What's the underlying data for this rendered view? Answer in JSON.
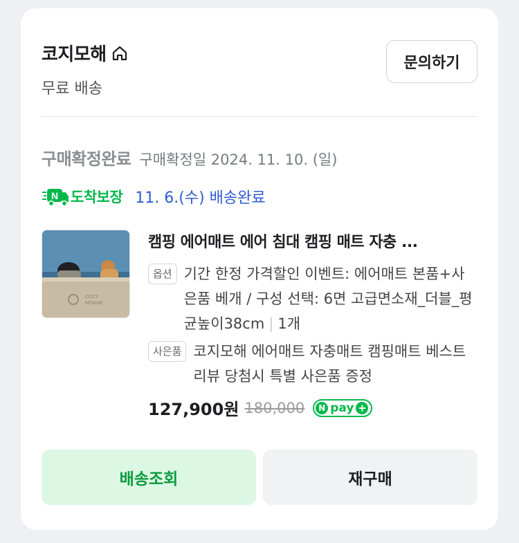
{
  "store": {
    "name": "코지모해",
    "shipping": "무료 배송",
    "inquiry_label": "문의하기"
  },
  "order": {
    "status": "구매확정완료",
    "status_date": "구매확정일 2024. 11. 10. (일)",
    "guarantee_label": "도착보장",
    "delivery_status": "11. 6.(수) 배송완료"
  },
  "product": {
    "title": "캠핑 에어매트 에어 침대 캠핑 매트 자충 ...",
    "image_text_1": "COZY",
    "image_text_2": "MOHAE",
    "option_tag": "옵션",
    "option_text": "기간 한정 가격할인 이벤트: 에어매트 본품+사은품 베개 / 구성 선택: 6면 고급면소재_더블_평균높이38cm",
    "quantity": "1개",
    "gift_tag": "사은품",
    "gift_text": "코지모해 에어매트 자충매트 캠핑매트 베스트 리뷰 당첨시 특별 사은품 증정",
    "price": "127,900원",
    "original_price": "180,000",
    "npay_label": "pay"
  },
  "actions": {
    "track_label": "배송조회",
    "rebuy_label": "재구매"
  },
  "colors": {
    "brand_green": "#06b84c",
    "link_blue": "#2f5bd3"
  }
}
